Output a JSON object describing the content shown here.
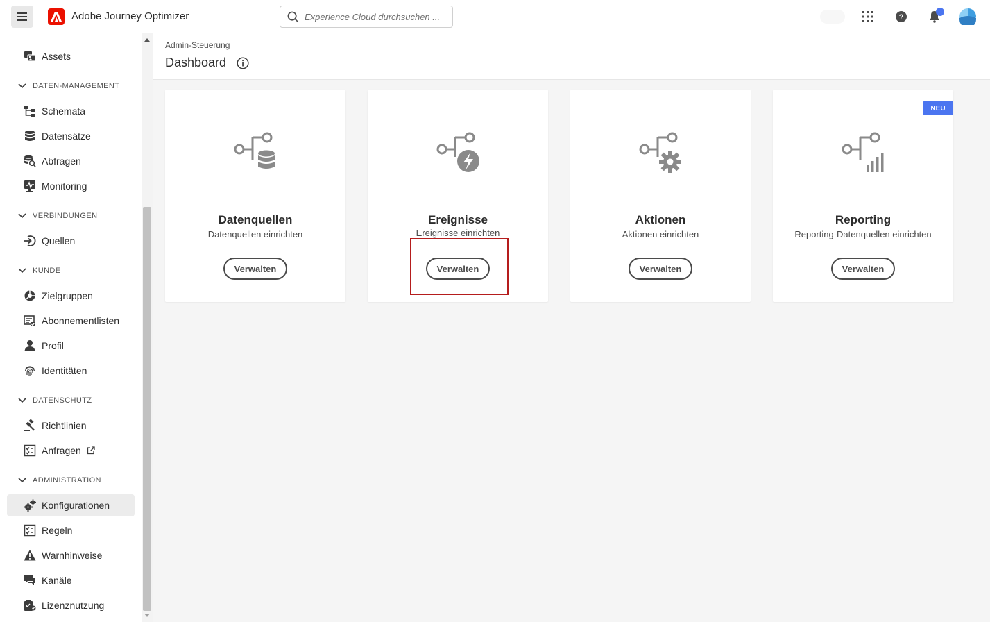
{
  "header": {
    "app_title": "Adobe Journey Optimizer",
    "search_placeholder": "Experience Cloud durchsuchen ..."
  },
  "sidebar": {
    "items": [
      {
        "label": "Assets",
        "icon": "assets-icon"
      },
      {
        "section": "DATEN-MANAGEMENT"
      },
      {
        "label": "Schemata",
        "icon": "schema-icon"
      },
      {
        "label": "Datensätze",
        "icon": "database-icon"
      },
      {
        "label": "Abfragen",
        "icon": "query-icon"
      },
      {
        "label": "Monitoring",
        "icon": "monitoring-icon"
      },
      {
        "section": "VERBINDUNGEN"
      },
      {
        "label": "Quellen",
        "icon": "sources-icon"
      },
      {
        "section": "KUNDE"
      },
      {
        "label": "Zielgruppen",
        "icon": "audiences-icon"
      },
      {
        "label": "Abonnementlisten",
        "icon": "subscription-list-icon"
      },
      {
        "label": "Profil",
        "icon": "profile-icon"
      },
      {
        "label": "Identitäten",
        "icon": "fingerprint-icon"
      },
      {
        "section": "DATENSCHUTZ"
      },
      {
        "label": "Richtlinien",
        "icon": "policies-icon"
      },
      {
        "label": "Anfragen",
        "icon": "requests-icon"
      },
      {
        "section": "ADMINISTRATION"
      },
      {
        "label": "Konfigurationen",
        "icon": "configurations-icon",
        "active": true
      },
      {
        "label": "Regeln",
        "icon": "rules-icon"
      },
      {
        "label": "Warnhinweise",
        "icon": "alert-icon"
      },
      {
        "label": "Kanäle",
        "icon": "channels-icon"
      },
      {
        "label": "Lizenznutzung",
        "icon": "license-usage-icon"
      }
    ]
  },
  "main": {
    "breadcrumb": "Admin-Steuerung",
    "title": "Dashboard",
    "cards": [
      {
        "title": "Datenquellen",
        "subtitle": "Datenquellen einrichten",
        "button": "Verwalten"
      },
      {
        "title": "Ereignisse",
        "subtitle": "Ereignisse einrichten",
        "button": "Verwalten"
      },
      {
        "title": "Aktionen",
        "subtitle": "Aktionen einrichten",
        "button": "Verwalten"
      },
      {
        "title": "Reporting",
        "subtitle": "Reporting-Datenquellen einrichten",
        "button": "Verwalten",
        "badge": "NEU"
      }
    ]
  },
  "colors": {
    "accent": "#4b75f0",
    "adobe_red": "#eb1000",
    "highlight": "#b51d1d"
  }
}
